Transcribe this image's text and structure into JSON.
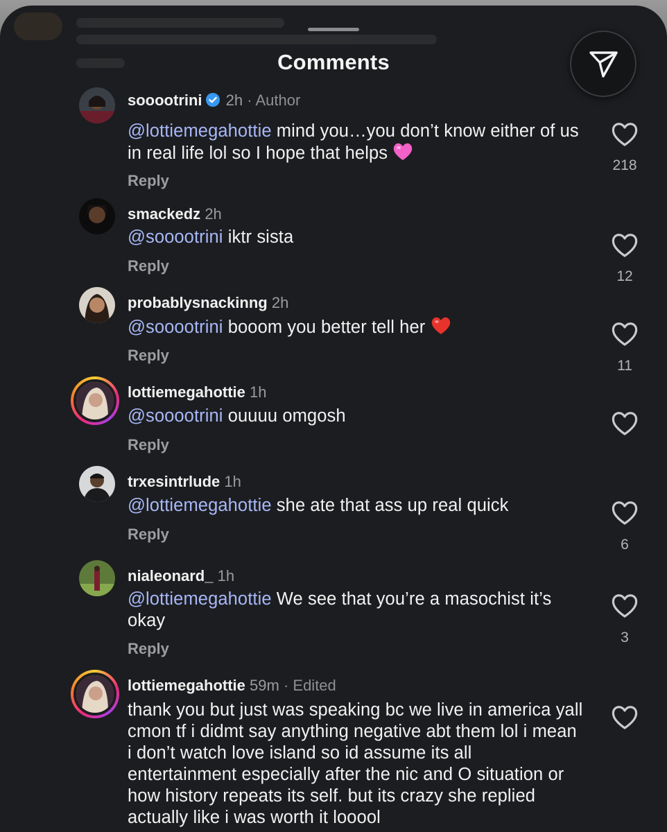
{
  "sheet": {
    "title": "Comments"
  },
  "comments": [
    {
      "username": "sooootrini",
      "verified": true,
      "time": "2h",
      "suffix": "· Author",
      "mention": "@lottiemegahottie",
      "text": " mind you…you don’t know either of us in real life lol so I hope that helps ",
      "emoji": "pink-heart",
      "reply": "Reply",
      "likes": "218"
    },
    {
      "username": "smackedz",
      "time": "2h",
      "mention": "@sooootrini",
      "text": " iktr sista",
      "reply": "Reply",
      "likes": "12"
    },
    {
      "username": "probablysnackinng",
      "time": "2h",
      "mention": "@sooootrini",
      "text": " booom you better tell her ",
      "emoji": "red-heart",
      "reply": "Reply",
      "likes": "11"
    },
    {
      "username": "lottiemegahottie",
      "time": "1h",
      "mention": "@sooootrini",
      "text": " ouuuu omgosh",
      "reply": "Reply",
      "likes": ""
    },
    {
      "username": "trxesintrlude",
      "time": "1h",
      "mention": "@lottiemegahottie",
      "text": " she ate that ass up real quick",
      "reply": "Reply",
      "likes": "6"
    },
    {
      "username": "nialeonard_",
      "time": "1h",
      "mention": "@lottiemegahottie",
      "text": " We see that you’re a masochist it’s okay",
      "reply": "Reply",
      "likes": "3"
    },
    {
      "username": "lottiemegahottie",
      "time": "59m",
      "suffix": "· Edited",
      "text": "thank you but just was speaking bc we live in america yall cmon tf i didmt say anything negative abt them lol i mean i don’t watch love island so id assume its all entertainment especially after the nic and O situation or how history repeats its self. but its crazy she replied actually like i was worth it looool",
      "likes": ""
    }
  ],
  "colors": {
    "sheet_bg": "#1c1d20",
    "mention": "#a8b8f8",
    "verified": "#3897f0"
  }
}
